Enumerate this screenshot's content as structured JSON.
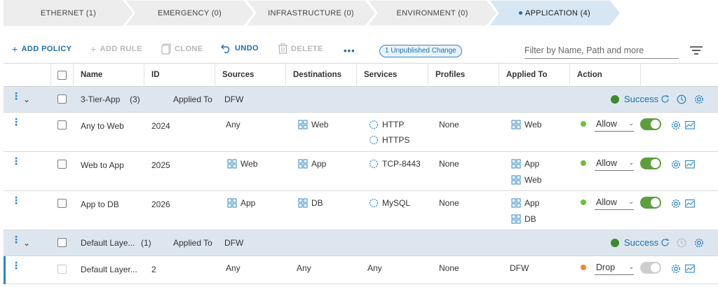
{
  "tabs": [
    {
      "label": "ETHERNET (1)"
    },
    {
      "label": "EMERGENCY (0)"
    },
    {
      "label": "INFRASTRUCTURE (0)"
    },
    {
      "label": "ENVIRONMENT (0)"
    },
    {
      "label": "APPLICATION (4)",
      "active": true
    }
  ],
  "toolbar": {
    "add_policy": "ADD POLICY",
    "add_rule": "ADD RULE",
    "clone": "CLONE",
    "undo": "UNDO",
    "delete": "DELETE",
    "more": "•••",
    "unpublished_badge": "1 Unpublished Change",
    "filter_placeholder": "Filter by Name, Path and more"
  },
  "columns": [
    "Name",
    "ID",
    "Sources",
    "Destinations",
    "Services",
    "Profiles",
    "Applied To",
    "Action"
  ],
  "sections": [
    {
      "name": "3-Tier-App",
      "count": "(3)",
      "applied_label": "Applied To",
      "applied_to": "DFW",
      "status": "Success"
    },
    {
      "name": "Default Laye...",
      "count": "(1)",
      "applied_label": "Applied To",
      "applied_to": "DFW",
      "status": "Success"
    }
  ],
  "rules": [
    {
      "name": "Any to Web",
      "id": "2024",
      "sources": [
        "Any"
      ],
      "destinations": [
        "Web"
      ],
      "services": [
        "HTTP",
        "HTTPS"
      ],
      "profiles": "None",
      "applied_to": [
        "Web"
      ],
      "action": "Allow",
      "enabled": true
    },
    {
      "name": "Web to App",
      "id": "2025",
      "sources": [
        "Web"
      ],
      "destinations": [
        "App"
      ],
      "services": [
        "TCP-8443"
      ],
      "profiles": "None",
      "applied_to": [
        "App",
        "Web"
      ],
      "action": "Allow",
      "enabled": true
    },
    {
      "name": "App to DB",
      "id": "2026",
      "sources": [
        "App"
      ],
      "destinations": [
        "DB"
      ],
      "services": [
        "MySQL"
      ],
      "profiles": "None",
      "applied_to": [
        "App",
        "DB"
      ],
      "action": "Allow",
      "enabled": true
    },
    {
      "name": "Default Layer...",
      "id": "2",
      "sources": [
        "Any"
      ],
      "destinations": [
        "Any"
      ],
      "services": [
        "Any"
      ],
      "profiles": "None",
      "applied_to": [
        "DFW"
      ],
      "action": "Drop",
      "enabled": false
    }
  ],
  "colors": {
    "accent": "#1b6fb0",
    "success": "#3d8a2e",
    "allow": "#6cbf3a",
    "drop": "#f08a24",
    "section_bg": "#dde6ef"
  }
}
